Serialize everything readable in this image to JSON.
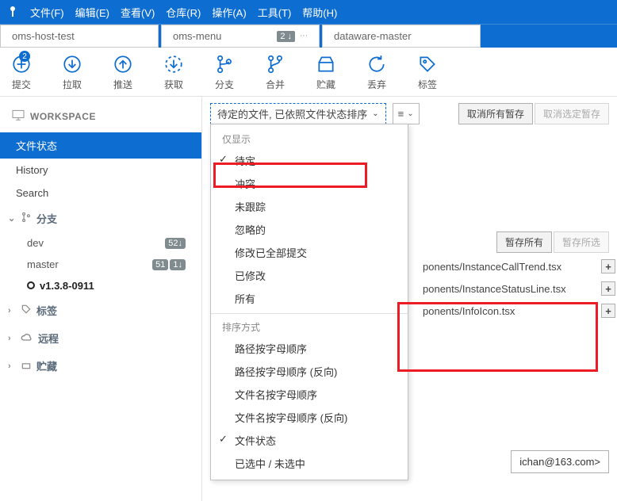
{
  "menubar": {
    "items": [
      "文件(F)",
      "编辑(E)",
      "查看(V)",
      "仓库(R)",
      "操作(A)",
      "工具(T)",
      "帮助(H)"
    ]
  },
  "tabs": [
    {
      "label": "oms-host-test",
      "badge": ""
    },
    {
      "label": "oms-menu",
      "badge": "2 ↓"
    },
    {
      "label": "dataware-master",
      "badge": ""
    }
  ],
  "toolbar": [
    {
      "label": "提交",
      "icon": "plus-circle",
      "badge": "2"
    },
    {
      "label": "拉取",
      "icon": "down-circle",
      "badge": ""
    },
    {
      "label": "推送",
      "icon": "up-circle",
      "badge": ""
    },
    {
      "label": "获取",
      "icon": "dashed-down",
      "badge": ""
    },
    {
      "label": "分支",
      "icon": "branch",
      "badge": ""
    },
    {
      "label": "合并",
      "icon": "merge",
      "badge": ""
    },
    {
      "label": "贮藏",
      "icon": "stash",
      "badge": ""
    },
    {
      "label": "丢弃",
      "icon": "discard",
      "badge": ""
    },
    {
      "label": "标签",
      "icon": "tag",
      "badge": ""
    }
  ],
  "sidebar": {
    "workspace_header": "WORKSPACE",
    "workspace_items": [
      "文件状态",
      "History",
      "Search"
    ],
    "branches_header": "分支",
    "branches": [
      {
        "name": "dev",
        "badges": [
          "52↓"
        ],
        "bold": false,
        "dot": false
      },
      {
        "name": "master",
        "badges": [
          "51",
          "1↓"
        ],
        "bold": false,
        "dot": false
      },
      {
        "name": "v1.3.8-0911",
        "badges": [],
        "bold": true,
        "dot": true
      }
    ],
    "tags_header": "标签",
    "remote_header": "远程",
    "stash_header": "贮藏"
  },
  "filter": {
    "dropdown_label": "待定的文件, 已依照文件状态排序",
    "group1_title": "仅显示",
    "group1": [
      "待定",
      "冲突",
      "未跟踪",
      "忽略的",
      "修改已全部提交",
      "已修改",
      "所有"
    ],
    "group1_checked": 0,
    "group2_title": "排序方式",
    "group2": [
      "路径按字母顺序",
      "路径按字母顺序 (反向)",
      "文件名按字母顺序",
      "文件名按字母顺序 (反向)",
      "文件状态",
      "已选中 / 未选中"
    ],
    "group2_checked": 4
  },
  "actions": {
    "cancel_all_stage": "取消所有暂存",
    "cancel_selected_stage": "取消选定暂存",
    "stage_all": "暂存所有",
    "stage_selected": "暂存所选"
  },
  "files": [
    "ponents/InstanceCallTrend.tsx",
    "ponents/InstanceStatusLine.tsx",
    "ponents/InfoIcon.tsx"
  ],
  "email_partial": "ichan@163.com>"
}
